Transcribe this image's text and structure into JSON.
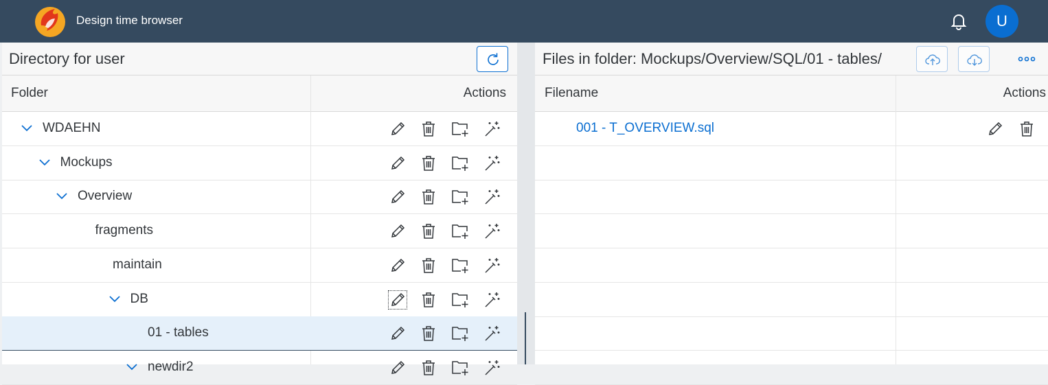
{
  "header": {
    "app_title": "Design time browser",
    "avatar_initial": "U",
    "colors": {
      "shell": "#354a5f",
      "accent": "#0a6ed1",
      "avatar": "#0a6ed1"
    }
  },
  "left": {
    "title": "Directory for user",
    "columns": {
      "folder": "Folder",
      "actions": "Actions"
    },
    "rows": [
      {
        "name": "WDAEHN",
        "expanded": true
      },
      {
        "name": "Mockups",
        "expanded": true
      },
      {
        "name": "Overview",
        "expanded": true
      },
      {
        "name": "fragments",
        "expanded": false
      },
      {
        "name": "maintain",
        "expanded": false
      },
      {
        "name": "DB",
        "expanded": true
      },
      {
        "name": "01 - tables",
        "expanded": false,
        "selected": true
      },
      {
        "name": "newdir2",
        "expanded": true
      }
    ],
    "row_actions": [
      "edit-icon",
      "delete-icon",
      "add-folder-icon",
      "wizard-icon"
    ]
  },
  "right": {
    "title": "Files in folder: Mockups/Overview/SQL/01 - tables/",
    "columns": {
      "filename": "Filename",
      "actions": "Actions"
    },
    "files": [
      {
        "name": "001 - T_OVERVIEW.sql"
      }
    ],
    "row_actions": [
      "edit-icon",
      "delete-icon"
    ]
  }
}
